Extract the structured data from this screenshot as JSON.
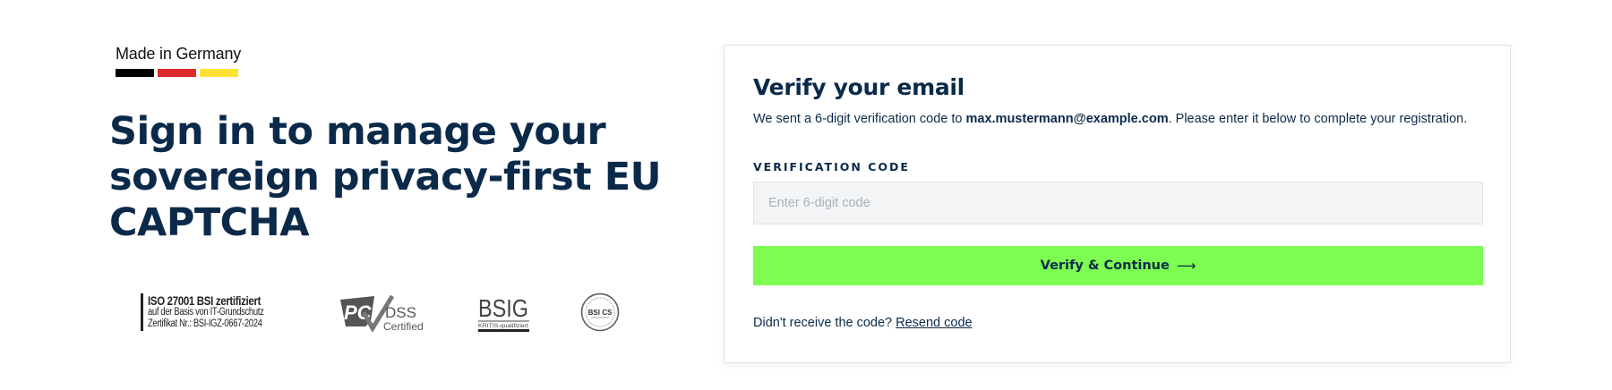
{
  "branding": {
    "made_in_label": "Made in Germany",
    "flag_colors": [
      "#000000",
      "#dd2b2b",
      "#ffe234"
    ]
  },
  "hero": {
    "headline": "Sign in to manage your sovereign privacy-first EU CAPTCHA"
  },
  "certifications": {
    "iso": {
      "line1": "ISO 27001 BSI zertifiziert",
      "line2": "auf der Basis von IT-Grundschutz",
      "line3": "Zertifikat Nr.: BSI-IGZ-0667-2024"
    },
    "pci": {
      "mark": "PCI",
      "dss": "DSS",
      "certified": "Certified"
    },
    "bsig": {
      "mark": "BSIG",
      "sub": "KRITIS-qualifiziert"
    },
    "bsics": {
      "mark": "BSI CS"
    }
  },
  "verify": {
    "title": "Verify your email",
    "desc_prefix": "We sent a 6-digit verification code to ",
    "email": "max.mustermann@example.com",
    "desc_suffix": ". Please enter it below to complete your registration.",
    "code_label": "VERIFICATION CODE",
    "code_value": "",
    "code_placeholder": "Enter 6-digit code",
    "button_label": "Verify & Continue",
    "button_icon": "arrow-right-icon",
    "resend_prompt": "Didn't receive the code? ",
    "resend_link": "Resend code"
  },
  "colors": {
    "navy": "#0b2a4a",
    "button_green": "#7dfc51",
    "input_bg": "#f2f4f6"
  }
}
